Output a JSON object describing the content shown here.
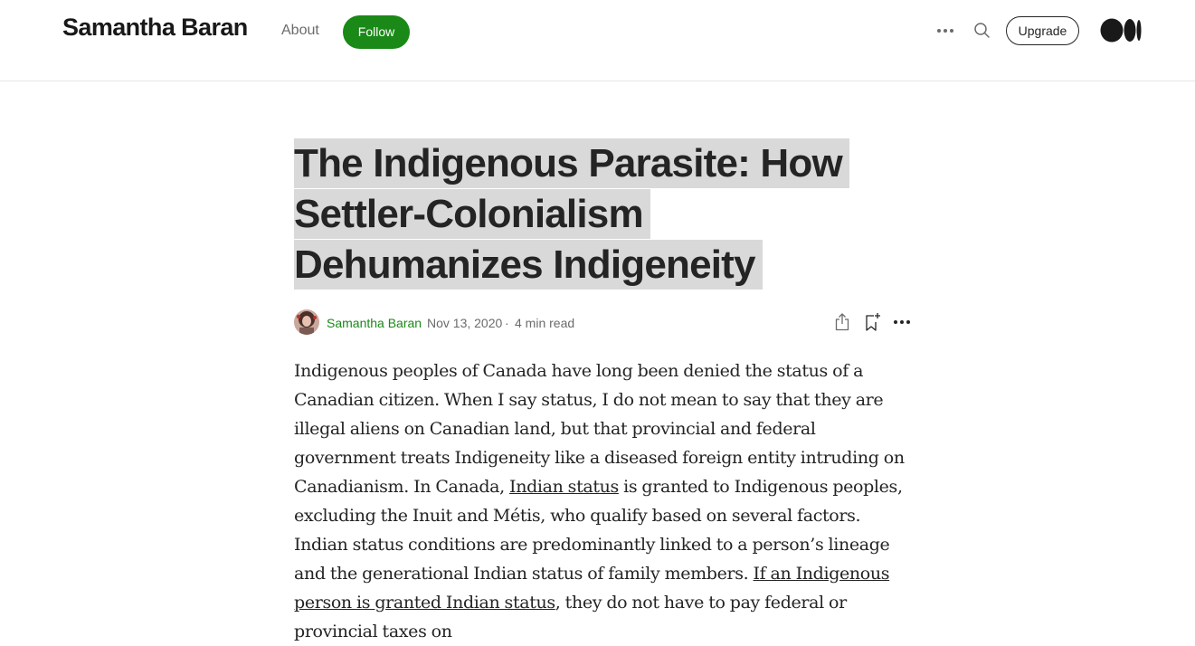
{
  "header": {
    "publication_name": "Samantha Baran",
    "about_label": "About",
    "follow_label": "Follow",
    "upgrade_label": "Upgrade"
  },
  "article": {
    "title_lines": [
      "The Indigenous Parasite: How",
      "Settler-Colonialism",
      "Dehumanizes Indigeneity"
    ],
    "author": "Samantha Baran",
    "date": "Nov 13, 2020",
    "separator": "·",
    "read_time": "4 min read",
    "body": {
      "p1_a": "Indigenous peoples of Canada have long been denied the status of a Canadian citizen. When I say status, I do not mean to say that they are illegal aliens on Canadian land, but that provincial and federal government treats Indigeneity like a diseased foreign entity intruding on Canadianism. In Canada, ",
      "link1": "Indian status",
      "p1_b": " is granted to Indigenous peoples, excluding the Inuit and Métis, who qualify based on several factors. Indian status conditions are predominantly linked to a person’s lineage and the generational Indian status of family members. ",
      "link2": "If an Indigenous person is granted Indian status",
      "p1_c": ", they do not have to pay federal or provincial taxes on"
    }
  },
  "icons": {
    "more_top": "more-horizontal-icon",
    "search": "search-icon",
    "logo": "medium-logo-icon",
    "share": "share-icon",
    "bookmark": "bookmark-add-icon",
    "more_article": "more-horizontal-icon"
  },
  "colors": {
    "accent": "#1a8917",
    "title_highlight": "#d9d9d9",
    "text": "#242424",
    "muted": "#6b6b6b"
  }
}
